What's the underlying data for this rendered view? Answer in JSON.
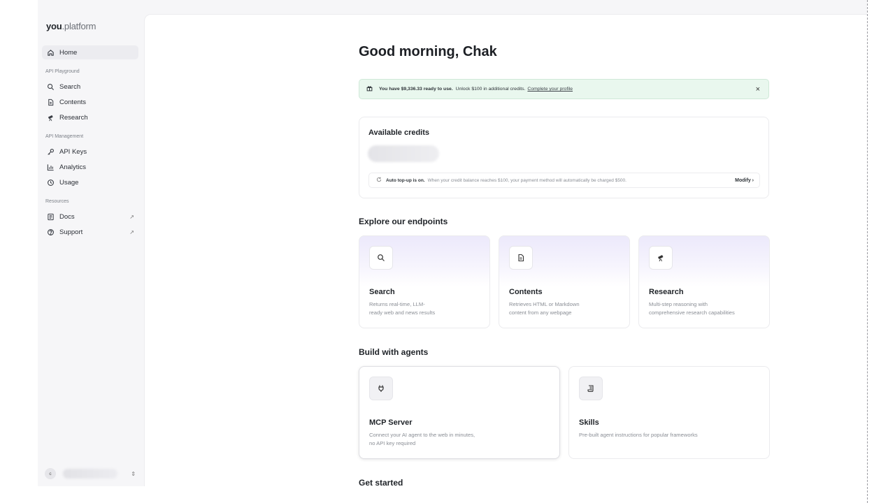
{
  "app": {
    "logo_bold": "you",
    "logo_light": ".platform"
  },
  "sidebar": {
    "home": "Home",
    "sections": [
      {
        "label": "API Playground",
        "items": [
          "Search",
          "Contents",
          "Research"
        ]
      },
      {
        "label": "API Management",
        "items": [
          "API Keys",
          "Analytics",
          "Usage"
        ]
      },
      {
        "label": "Resources",
        "items": [
          "Docs",
          "Support"
        ]
      }
    ],
    "external_glyph": "↗",
    "user_initial": "c",
    "user_chevron": "⇕"
  },
  "main": {
    "greeting": "Good morning, Chak",
    "banner": {
      "strong": "You have $9,336.33 ready to use.",
      "text": "Unlock $100 in additional credits.",
      "link": "Complete your profile",
      "close": "×"
    },
    "credits": {
      "title": "Available credits",
      "topup_strong": "Auto top-up is on.",
      "topup_text": "When your credit balance reaches $100, your payment method will automatically be charged $500.",
      "modify": "Modify ›"
    },
    "endpoints": {
      "title": "Explore our endpoints",
      "cards": [
        {
          "icon": "search-icon",
          "title": "Search",
          "desc1": "Returns real-time, LLM-",
          "desc2": "ready web and news results"
        },
        {
          "icon": "document-icon",
          "title": "Contents",
          "desc1": "Retrieves HTML or Markdown",
          "desc2": "content from any webpage"
        },
        {
          "icon": "telescope-icon",
          "title": "Research",
          "desc1": "Multi-step reasoning with",
          "desc2": "comprehensive research capabilities"
        }
      ]
    },
    "agents": {
      "title": "Build with agents",
      "cards": [
        {
          "icon": "plug-icon",
          "title": "MCP Server",
          "desc1": "Connect your AI agent to the web in minutes,",
          "desc2": "no API key required"
        },
        {
          "icon": "scroll-icon",
          "title": "Skills",
          "desc1": "Pre-built agent instructions for popular frameworks",
          "desc2": ""
        }
      ]
    },
    "get_started": "Get started"
  }
}
